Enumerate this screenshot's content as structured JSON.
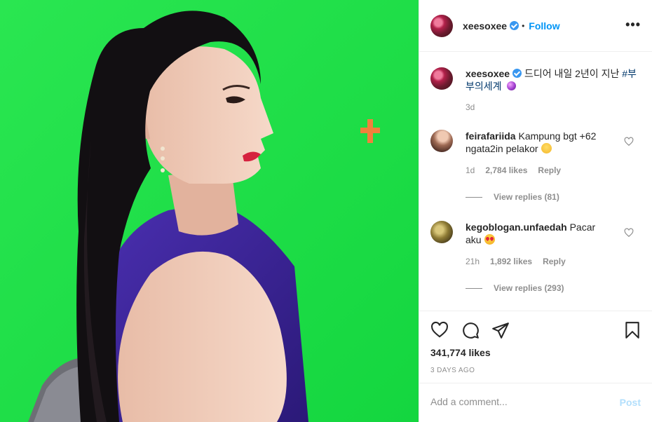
{
  "header": {
    "username": "xeesoxee",
    "separator": "•",
    "follow_label": "Follow",
    "more_label": "•••",
    "more_icon": "more-horizontal-icon"
  },
  "caption": {
    "username": "xeesoxee",
    "text": "드디어 내일 2년이 지난",
    "hashtag": "#부부의세계",
    "time": "3d"
  },
  "comments": [
    {
      "username": "feirafariida",
      "text": "Kampung bgt +62 ngata2in pelakor",
      "time": "1d",
      "likes": "2,784 likes",
      "reply_label": "Reply",
      "view_replies": "View replies (81)"
    },
    {
      "username": "kegoblogan.unfaedah",
      "text": "Pacar aku",
      "time": "21h",
      "likes": "1,892 likes",
      "reply_label": "Reply",
      "view_replies": "View replies (293)"
    }
  ],
  "actions": {
    "likes": "341,774 likes",
    "posted": "3 DAYS AGO"
  },
  "add_comment": {
    "placeholder": "Add a comment...",
    "post_label": "Post"
  },
  "colors": {
    "accent": "#0095f6",
    "screen_green": "#1ee04a",
    "post_disabled": "#b2dffc"
  }
}
